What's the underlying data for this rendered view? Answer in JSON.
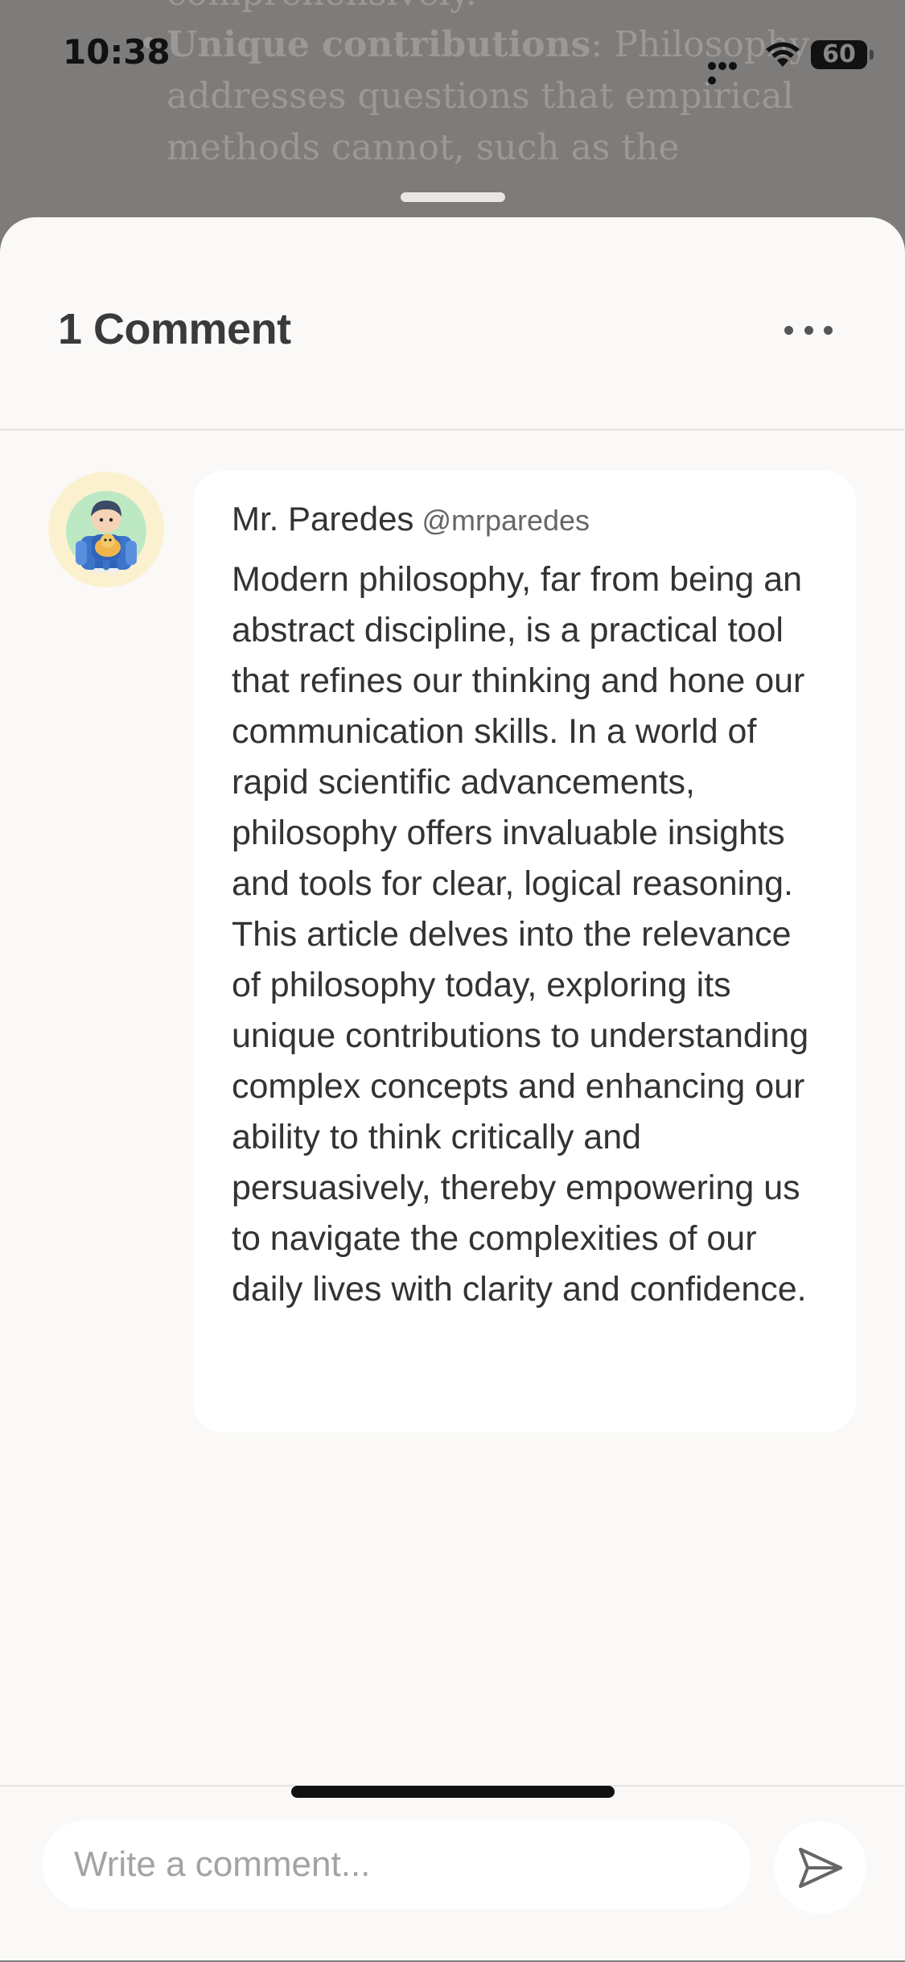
{
  "status_bar": {
    "time": "10:38",
    "battery": "60"
  },
  "background_article": {
    "lines": [
      "comprehensively.",
      "Unique contributions",
      ": Philosophy",
      "addresses questions that empirical",
      "methods cannot, such as the"
    ]
  },
  "sheet": {
    "title": "1 Comment",
    "more_icon": "more-horizontal-icon"
  },
  "comment": {
    "author": "Mr. Paredes",
    "handle": "@mrparedes",
    "text": "Modern philosophy, far from being an abstract discipline, is a practical tool that refines our thinking and hone our communication skills. In a world of rapid scientific advancements, philosophy offers invaluable insights and tools for clear, logical reasoning. This article delves into the relevance of philosophy today, exploring its unique contributions to understanding complex concepts and enhancing our ability to think critically and persuasively, thereby empowering us to navigate the complexities of our daily lives with clarity and confidence."
  },
  "composer": {
    "placeholder": "Write a comment...",
    "send_icon": "send-icon"
  },
  "colors": {
    "sheet_background": "#faf9f7",
    "bubble_background": "#ffffff",
    "dim_overlay": "#7e7c7a",
    "text_primary": "#333333",
    "avatar_background": "#fbf1cf"
  }
}
